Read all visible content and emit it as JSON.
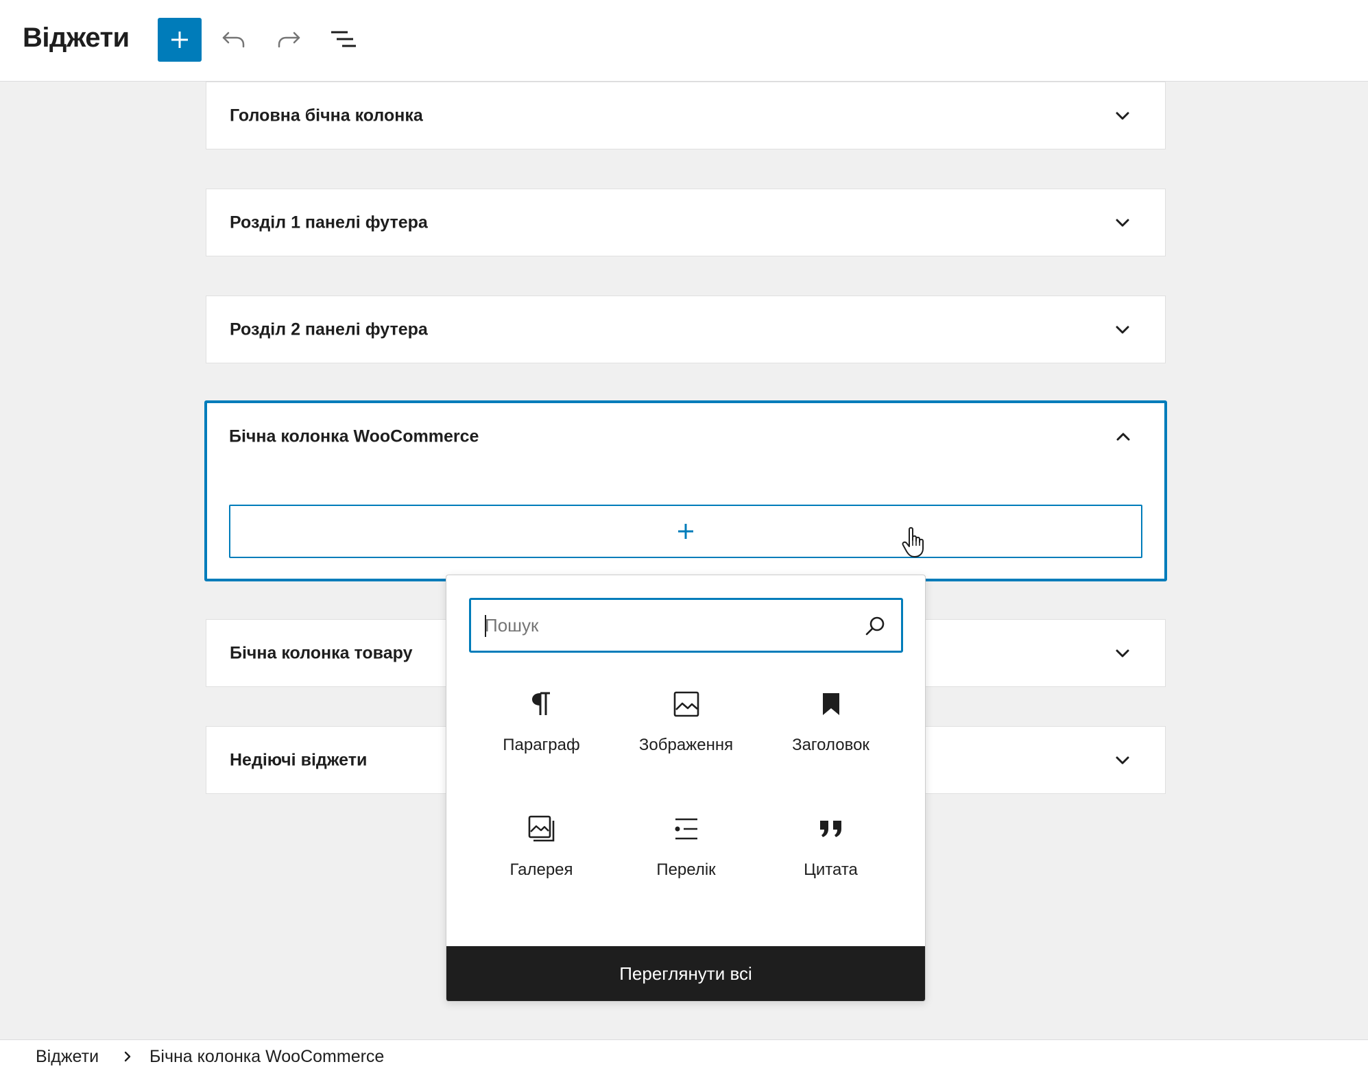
{
  "header": {
    "title": "Віджети",
    "add_icon": "plus-icon",
    "undo_icon": "undo-icon",
    "redo_icon": "redo-icon",
    "list_view_icon": "list-view-icon"
  },
  "widget_areas": [
    {
      "title": "Головна бічна колонка",
      "expanded": false
    },
    {
      "title": "Розділ 1 панелі футера",
      "expanded": false
    },
    {
      "title": "Розділ 2 панелі футера",
      "expanded": false
    },
    {
      "title": "Бічна колонка WooCommerce",
      "expanded": true
    },
    {
      "title": "Бічна колонка товару",
      "expanded": false
    },
    {
      "title": "Недіючі віджети",
      "expanded": false
    }
  ],
  "inserter": {
    "search_placeholder": "Пошук",
    "blocks": [
      {
        "label": "Параграф",
        "icon": "paragraph-icon"
      },
      {
        "label": "Зображення",
        "icon": "image-icon"
      },
      {
        "label": "Заголовок",
        "icon": "bookmark-icon"
      },
      {
        "label": "Галерея",
        "icon": "gallery-icon"
      },
      {
        "label": "Перелік",
        "icon": "list-icon"
      },
      {
        "label": "Цитата",
        "icon": "quote-icon"
      }
    ],
    "browse_all_label": "Переглянути всі"
  },
  "breadcrumb": {
    "items": [
      "Віджети",
      "Бічна колонка WooCommerce"
    ]
  },
  "colors": {
    "accent": "#007cba",
    "dark": "#1e1e1e",
    "canvas": "#f0f0f0"
  }
}
